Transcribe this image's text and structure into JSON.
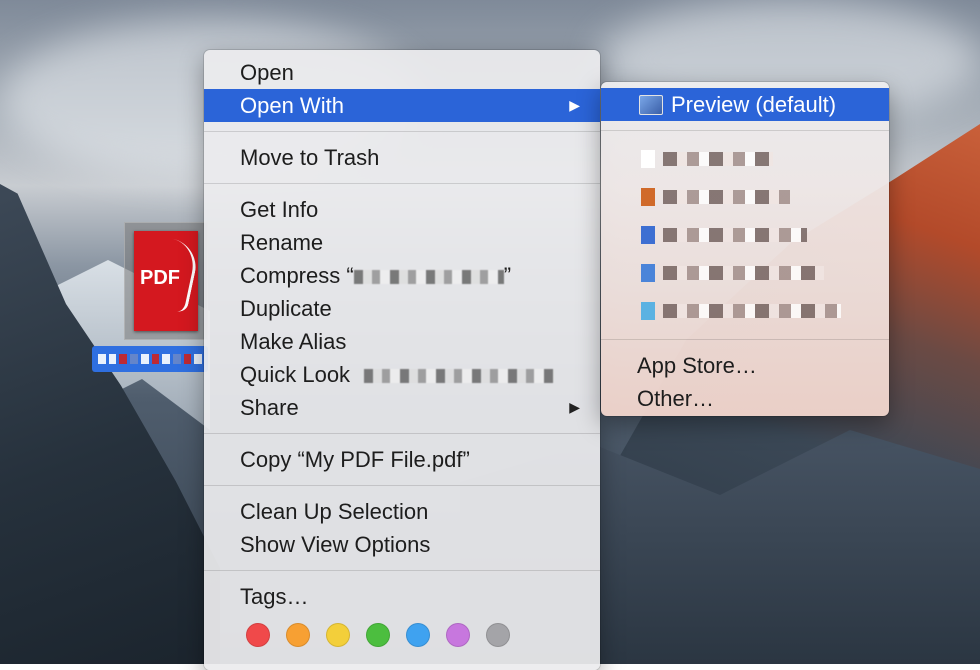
{
  "file": {
    "thumbnail_text": "PDF"
  },
  "main_menu": {
    "items": [
      {
        "label": "Open"
      },
      {
        "label": "Open With",
        "arrow": "▶"
      },
      {
        "label": "Move to Trash"
      },
      {
        "label": "Get Info"
      },
      {
        "label": "Rename"
      },
      {
        "label": "Compress “",
        "suffix": "”"
      },
      {
        "label": "Duplicate"
      },
      {
        "label": "Make Alias"
      },
      {
        "label": "Quick Look"
      },
      {
        "label": "Share",
        "arrow": "▶"
      },
      {
        "label": "Copy “My PDF File.pdf”"
      },
      {
        "label": "Clean Up Selection"
      },
      {
        "label": "Show View Options"
      },
      {
        "label": "Tags…"
      }
    ],
    "tag_colors": [
      {
        "name": "red",
        "color": "#f0494a"
      },
      {
        "name": "orange",
        "color": "#f7a033"
      },
      {
        "name": "yellow",
        "color": "#f3cf3a"
      },
      {
        "name": "green",
        "color": "#4cbe3f"
      },
      {
        "name": "blue",
        "color": "#3fa2f0"
      },
      {
        "name": "purple",
        "color": "#c777de"
      },
      {
        "name": "gray",
        "color": "#a4a4a8"
      }
    ]
  },
  "open_with_menu": {
    "default_app": "Preview (default)",
    "other_apps": [
      {
        "icon_color": "#ffffff"
      },
      {
        "icon_color": "#d06a2a"
      },
      {
        "icon_color": "#3d6fd2"
      },
      {
        "icon_color": "#4a84d9"
      },
      {
        "icon_color": "#5bb2e2"
      }
    ],
    "app_store": "App Store…",
    "other": "Other…"
  },
  "colors": {
    "selection": "#2b64d8"
  }
}
